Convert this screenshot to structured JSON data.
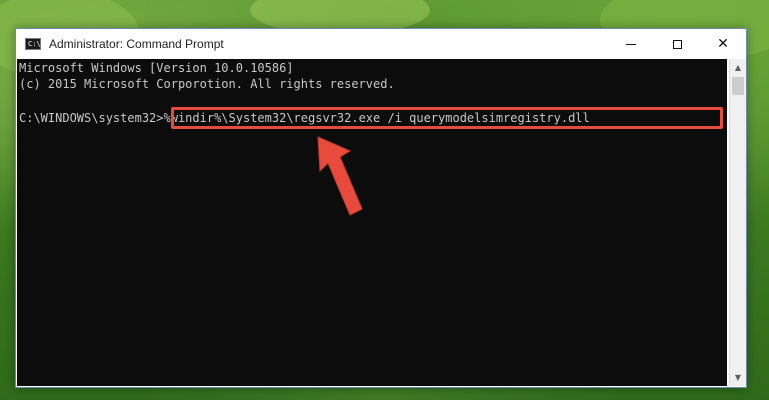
{
  "window": {
    "title": "Administrator: Command Prompt",
    "icon_text": "C:\\.",
    "controls": {
      "minimize": "minimize-icon",
      "maximize": "maximize-icon",
      "close_glyph": "✕"
    }
  },
  "console": {
    "lines": [
      "Microsoft Windows [Version 10.0.10586]",
      "(c) 2015 Microsoft Corporotion. All rights reserved.",
      "",
      "C:\\WINDOWS\\system32>"
    ],
    "command": "%windir%\\System32\\regsvr32.exe /i querymodelsimregistry.dll"
  },
  "annotation": {
    "highlight_color": "#e84b3c",
    "arrow_color": "#e84b3c"
  },
  "colors": {
    "console_bg": "#0c0c0c",
    "console_fg": "#c8c8c8",
    "titlebar_bg": "#ffffff"
  }
}
